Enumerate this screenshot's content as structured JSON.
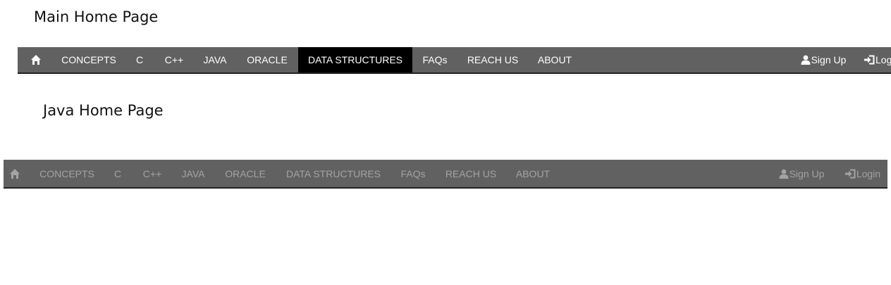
{
  "main_page": {
    "title": "Main Home Page",
    "nav": {
      "home_icon": "home-icon",
      "items": [
        {
          "label": "CONCEPTS"
        },
        {
          "label": "C"
        },
        {
          "label": "C++"
        },
        {
          "label": "JAVA"
        },
        {
          "label": "ORACLE"
        },
        {
          "label": "DATA STRUCTURES",
          "active": true
        },
        {
          "label": "FAQs"
        },
        {
          "label": "REACH US"
        },
        {
          "label": "ABOUT"
        }
      ],
      "signup": {
        "icon": "user-icon",
        "label": "Sign Up"
      },
      "login": {
        "icon": "login-icon",
        "label": "Log"
      }
    }
  },
  "java_page": {
    "title": "Java Home Page",
    "nav": {
      "home_icon": "home-icon",
      "items": [
        {
          "label": "CONCEPTS"
        },
        {
          "label": "C"
        },
        {
          "label": "C++"
        },
        {
          "label": "JAVA"
        },
        {
          "label": "ORACLE"
        },
        {
          "label": "DATA STRUCTURES"
        },
        {
          "label": "FAQs"
        },
        {
          "label": "REACH US"
        },
        {
          "label": "ABOUT"
        }
      ],
      "signup": {
        "icon": "user-icon",
        "label": "Sign Up"
      },
      "login": {
        "icon": "login-icon",
        "label": "Login"
      }
    }
  },
  "colors": {
    "navbar_bg": "#616161",
    "active_bg": "#000000",
    "active_text": "#ffffff",
    "dimmed_text": "#a3a3a3"
  }
}
